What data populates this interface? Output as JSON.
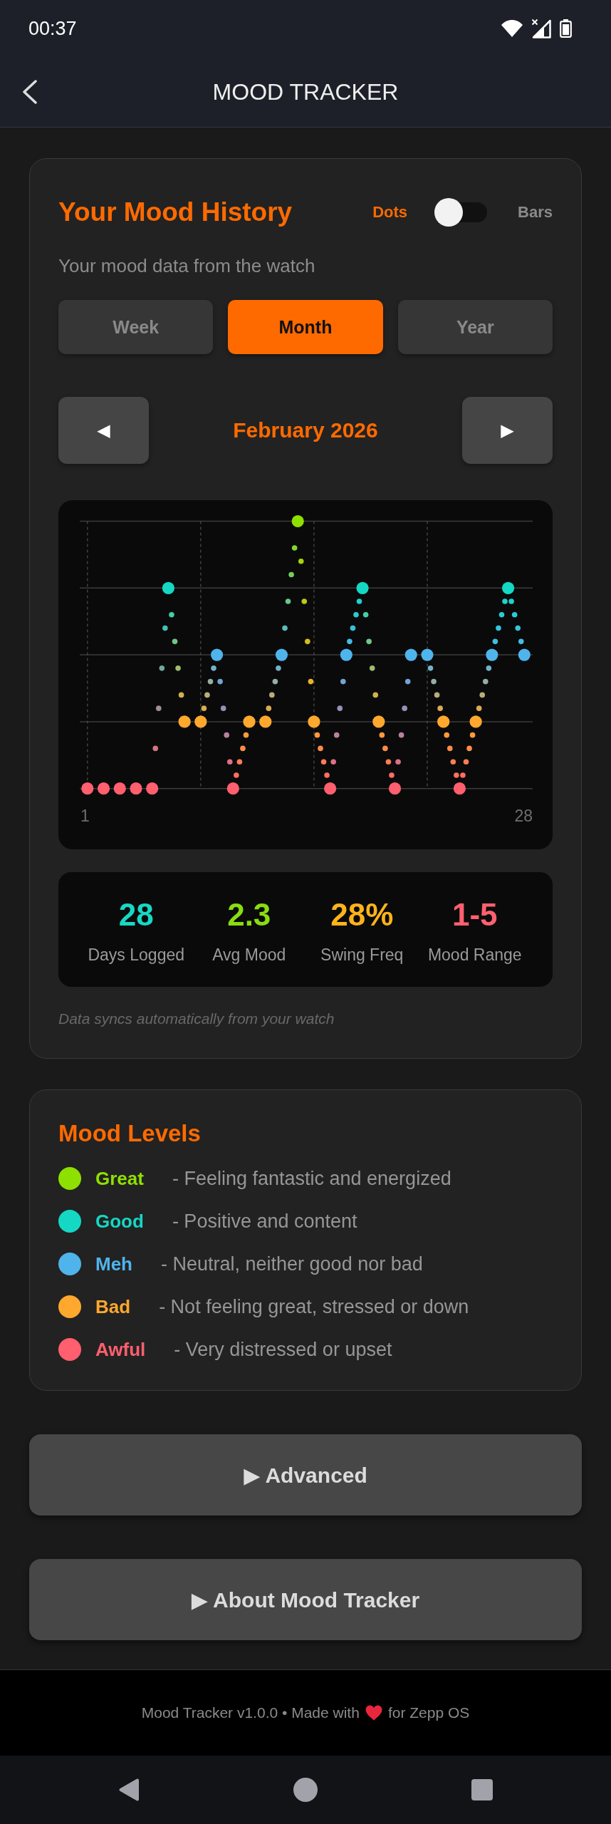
{
  "status_bar": {
    "time": "00:37"
  },
  "header": {
    "title": "MOOD TRACKER"
  },
  "history": {
    "title": "Your Mood History",
    "view_toggle": [
      {
        "label": "Dots",
        "selected": true
      },
      {
        "label": "Bars",
        "selected": false
      }
    ],
    "subtitle": "Your mood data from the watch",
    "periods": [
      {
        "label": "Week",
        "selected": false
      },
      {
        "label": "Month",
        "selected": true
      },
      {
        "label": "Year",
        "selected": false
      }
    ],
    "nav": {
      "prev": "◀",
      "label": "February 2026",
      "next": "▶"
    },
    "chart": {
      "axis_labels": [
        "1",
        "28"
      ]
    },
    "stats": [
      {
        "value": "28",
        "label": "Days Logged",
        "color": "#17d8c4"
      },
      {
        "value": "2.3",
        "label": "Avg Mood",
        "color": "#88dd10"
      },
      {
        "value": "28%",
        "label": "Swing Freq",
        "color": "#ffb31a"
      },
      {
        "value": "1-5",
        "label": "Mood Range",
        "color": "#ff6070"
      }
    ],
    "note": "Data syncs automatically from your watch"
  },
  "legend": {
    "title": "Mood Levels",
    "items": [
      {
        "name": "Great",
        "description": "- Feeling fantastic and energized",
        "color": "#8ee000"
      },
      {
        "name": "Good",
        "description": "- Positive and content",
        "color": "#14d8c4"
      },
      {
        "name": "Meh",
        "description": "- Neutral, neither good nor bad",
        "color": "#4fb4ec"
      },
      {
        "name": "Bad",
        "description": "- Not feeling great, stressed or down",
        "color": "#ffa82e"
      },
      {
        "name": "Awful",
        "description": "- Very distressed or upset",
        "color": "#ff5f6e"
      }
    ]
  },
  "buttons": [
    "▶ Advanced",
    "▶ About Mood Tracker"
  ],
  "footer": {
    "text_before": "Mood Tracker v1.0.0 • Made with",
    "text_after": "for Zepp OS"
  }
}
